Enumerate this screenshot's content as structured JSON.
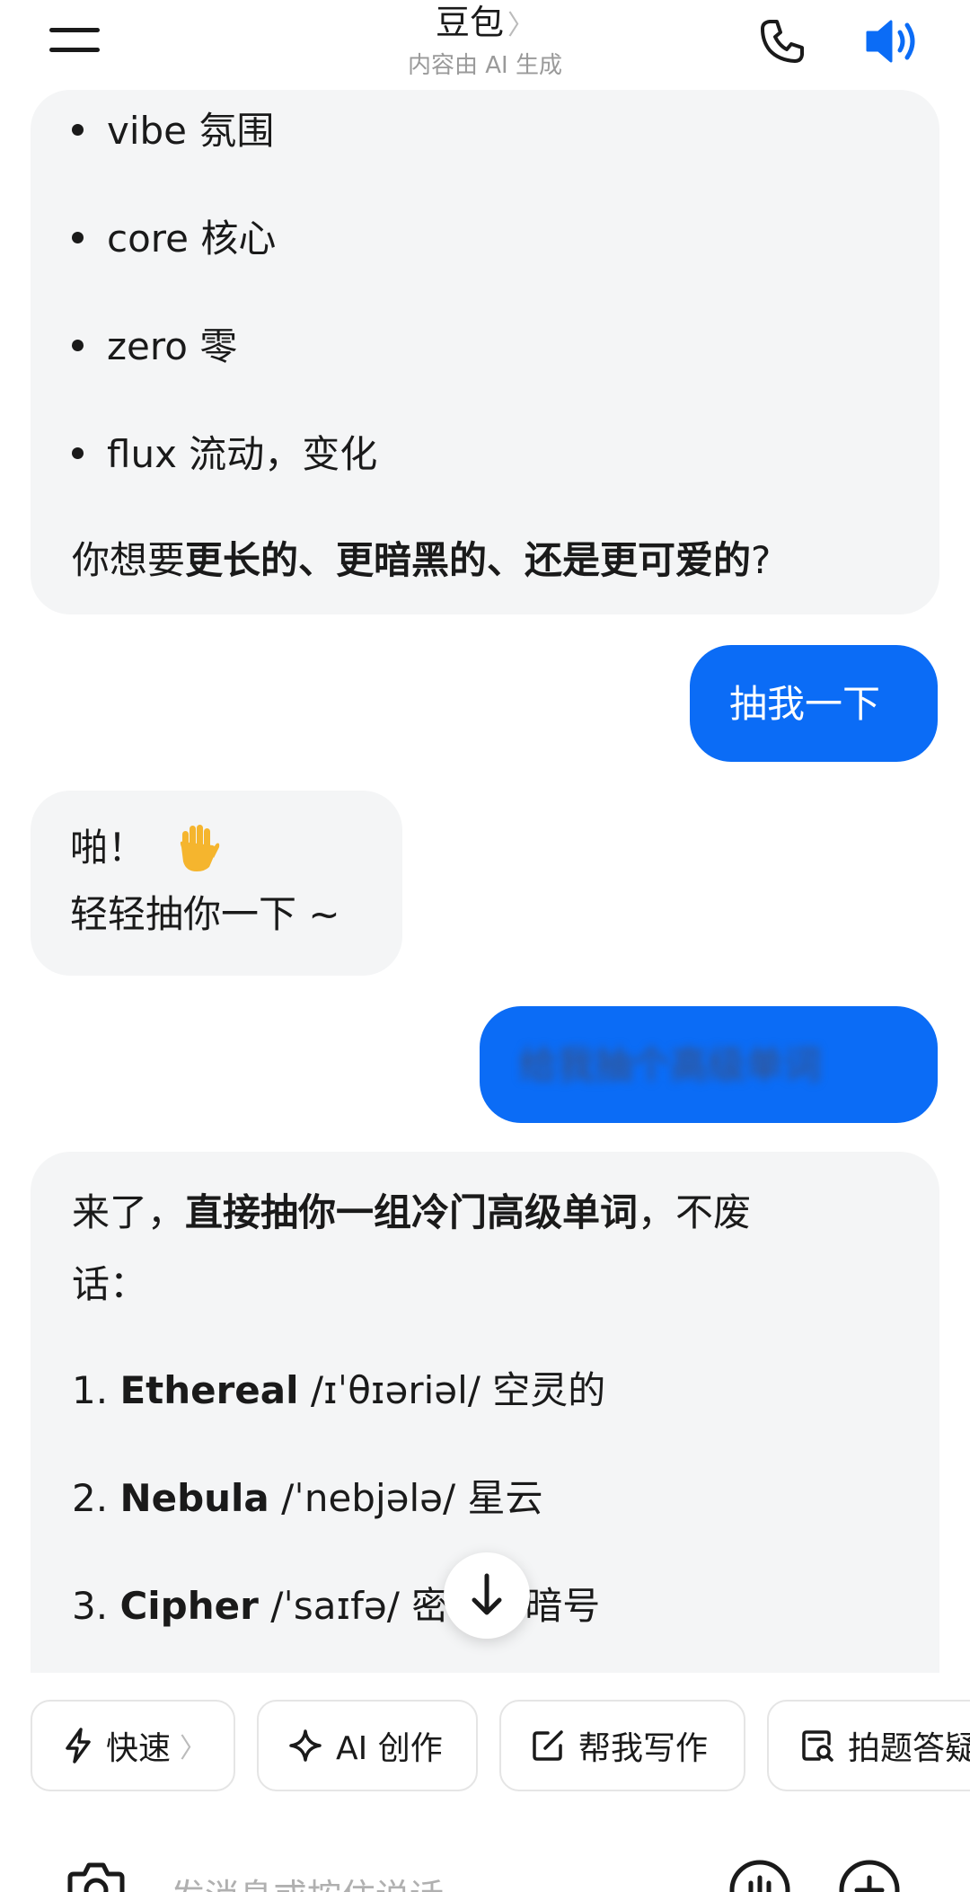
{
  "header": {
    "title": "豆包",
    "title_chevron": "〉",
    "subtitle": "内容由 AI 生成",
    "icons": [
      "menu-icon",
      "phone-icon",
      "speaker-icon"
    ],
    "accent_color": "#0b6cf6"
  },
  "messages": {
    "ai_1": {
      "bullets": [
        {
          "word": "vibe",
          "meaning": "氛围"
        },
        {
          "word": "core",
          "meaning": "核心"
        },
        {
          "word": "zero",
          "meaning": "零"
        },
        {
          "word": "flux",
          "meaning": "流动，变化"
        }
      ],
      "question_prefix": "你想要",
      "question_bold": "更长的、更暗黑的、还是更可爱的",
      "question_suffix": "?"
    },
    "user_1": {
      "text": "抽我一下"
    },
    "ai_2": {
      "line1": "啪！",
      "emoji": "🖐",
      "line2": "轻轻抽你一下 ~"
    },
    "user_2": {
      "text": "给我抽个高级单词"
    },
    "ai_3": {
      "intro_prefix": "来了，",
      "intro_bold": "直接抽你一组冷门高级单词",
      "intro_suffix": "，不废",
      "intro_line2": "话：",
      "words": [
        {
          "num": "1.",
          "word": "Ethereal",
          "pron": "/ɪˈθɪəriəl/",
          "meaning": "空灵的"
        },
        {
          "num": "2.",
          "word": "Nebula",
          "pron": "/ˈnebjələ/",
          "meaning": "星云"
        },
        {
          "num": "3.",
          "word": "Cipher",
          "pron": "/ˈsaɪfə/",
          "meaning": "密码，暗号"
        }
      ]
    }
  },
  "chips": [
    {
      "label": "快速",
      "icon": "lightning-icon",
      "chevron": "〉"
    },
    {
      "label": "AI 创作",
      "icon": "sparkle-icon"
    },
    {
      "label": "帮我写作",
      "icon": "edit-icon"
    },
    {
      "label": "拍题答疑",
      "icon": "scan-question-icon"
    }
  ],
  "input": {
    "placeholder": "发消息或按住说话",
    "icons": [
      "camera-icon",
      "voice-wave-icon",
      "add-icon"
    ]
  }
}
